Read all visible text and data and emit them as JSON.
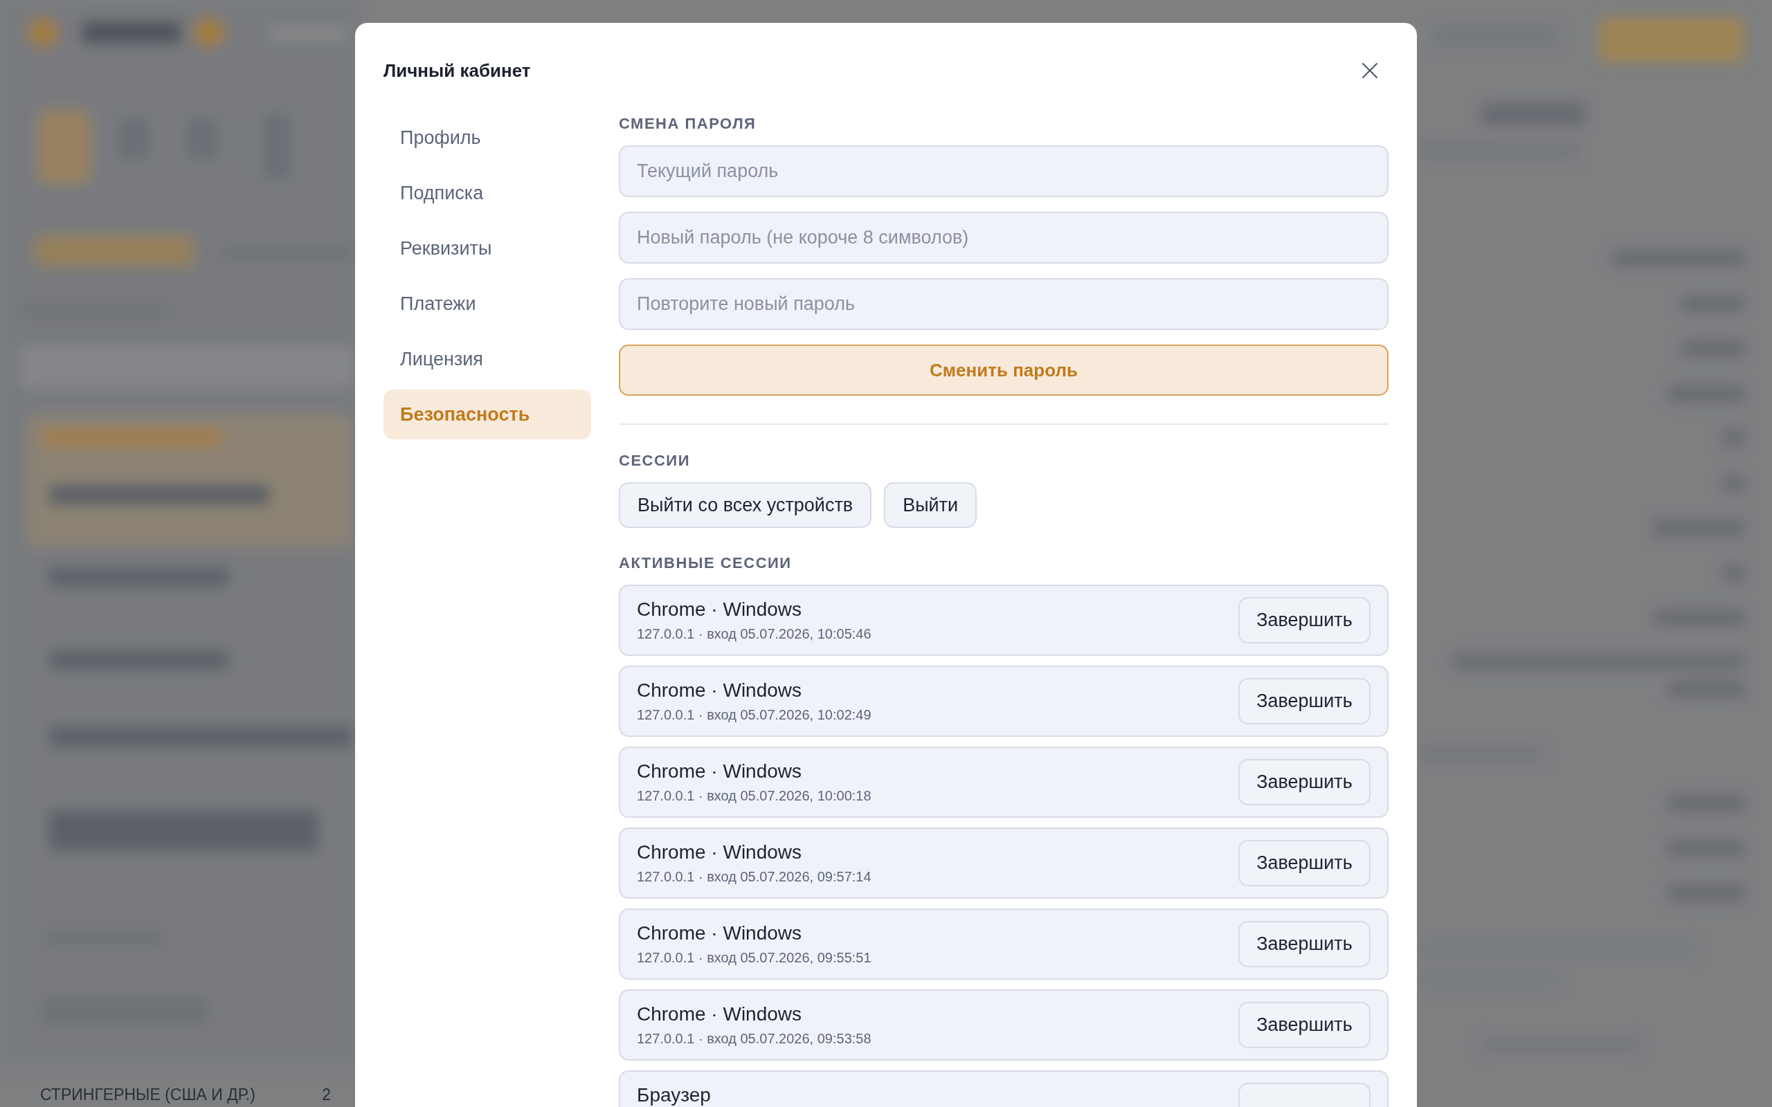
{
  "background": {
    "sidebar_group": {
      "label": "СТРИНГЕРНЫЕ (США И ДР.)",
      "count": "2"
    }
  },
  "modal": {
    "title": "Личный кабинет",
    "nav": [
      {
        "label": "Профиль",
        "selected": false
      },
      {
        "label": "Подписка",
        "selected": false
      },
      {
        "label": "Реквизиты",
        "selected": false
      },
      {
        "label": "Платежи",
        "selected": false
      },
      {
        "label": "Лицензия",
        "selected": false
      },
      {
        "label": "Безопасность",
        "selected": true
      }
    ],
    "password_section": {
      "heading": "СМЕНА ПАРОЛЯ",
      "fields": [
        {
          "placeholder": "Текущий пароль"
        },
        {
          "placeholder": "Новый пароль (не короче 8 символов)"
        },
        {
          "placeholder": "Повторите новый пароль"
        }
      ],
      "submit": "Сменить пароль"
    },
    "sessions_section": {
      "heading": "СЕССИИ",
      "buttons": [
        "Выйти со всех устройств",
        "Выйти"
      ]
    },
    "active_sessions": {
      "heading": "АКТИВНЫЕ СЕССИИ",
      "items": [
        {
          "title": "Chrome · Windows",
          "details": "127.0.0.1 · вход 05.07.2026, 10:05:46",
          "button": "Завершить"
        },
        {
          "title": "Chrome · Windows",
          "details": "127.0.0.1 · вход 05.07.2026, 10:02:49",
          "button": "Завершить"
        },
        {
          "title": "Chrome · Windows",
          "details": "127.0.0.1 · вход 05.07.2026, 10:00:18",
          "button": "Завершить"
        },
        {
          "title": "Chrome · Windows",
          "details": "127.0.0.1 · вход 05.07.2026, 09:57:14",
          "button": "Завершить"
        },
        {
          "title": "Chrome · Windows",
          "details": "127.0.0.1 · вход 05.07.2026, 09:55:51",
          "button": "Завершить"
        },
        {
          "title": "Chrome · Windows",
          "details": "127.0.0.1 · вход 05.07.2026, 09:53:58",
          "button": "Завершить"
        },
        {
          "title": "Браузер"
        }
      ]
    }
  }
}
